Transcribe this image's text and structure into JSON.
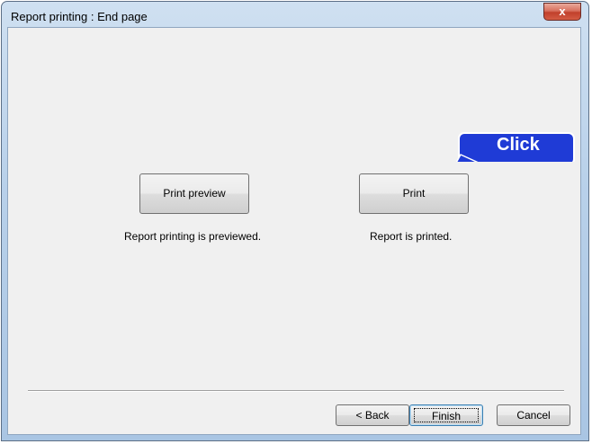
{
  "window": {
    "title": "Report printing : End page",
    "close_glyph": "x"
  },
  "options": [
    {
      "button_label": "Print preview",
      "caption": "Report printing is previewed."
    },
    {
      "button_label": "Print",
      "caption": "Report is printed."
    }
  ],
  "callout": {
    "text": "Click",
    "color": "#1f3bd6"
  },
  "footer": {
    "back_label": "< Back",
    "finish_label": "Finish",
    "cancel_label": "Cancel"
  }
}
